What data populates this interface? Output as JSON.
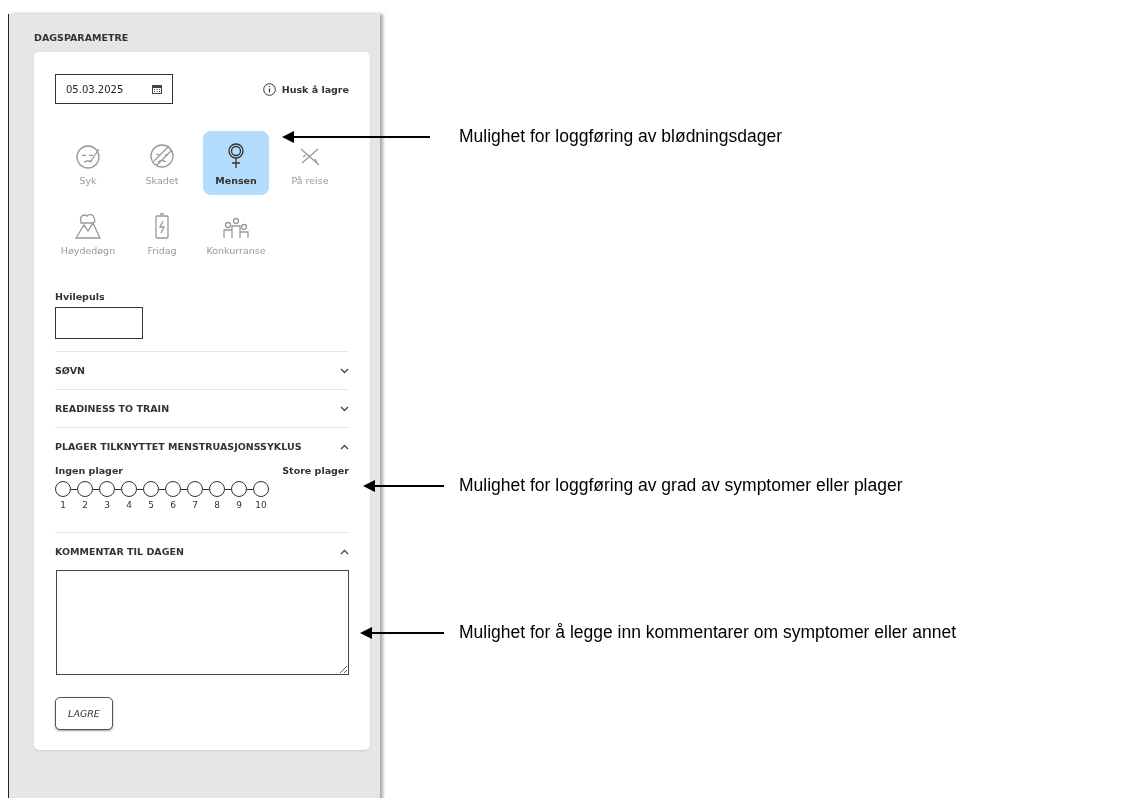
{
  "panel": {
    "title": "DAGSPARAMETRE"
  },
  "date_field": {
    "value": "05.03.2025"
  },
  "reminder": "Husk å lagre",
  "day_types": [
    {
      "kind": "sick",
      "label": "Syk",
      "selected": false
    },
    {
      "kind": "injured",
      "label": "Skadet",
      "selected": false
    },
    {
      "kind": "period",
      "label": "Mensen",
      "selected": true
    },
    {
      "kind": "travel",
      "label": "På reise",
      "selected": false
    },
    {
      "kind": "altitude",
      "label": "Høydedøgn",
      "selected": false
    },
    {
      "kind": "dayoff",
      "label": "Fridag",
      "selected": false
    },
    {
      "kind": "competition",
      "label": "Konkurranse",
      "selected": false
    }
  ],
  "resting_pulse": {
    "label": "Hvilepuls"
  },
  "sections": [
    {
      "title": "SØVN",
      "expanded": false
    },
    {
      "title": "READINESS TO TRAIN",
      "expanded": false
    },
    {
      "title": "PLAGER TILKNYTTET MENSTRUASJONSSYKLUS",
      "expanded": true,
      "kind": "scale",
      "low_label": "Ingen plager",
      "high_label": "Store plager",
      "steps": [
        {
          "label": "1",
          "selected": false
        },
        {
          "label": "2",
          "selected": false
        },
        {
          "label": "3",
          "selected": false
        },
        {
          "label": "4",
          "selected": false
        },
        {
          "label": "5",
          "selected": false
        },
        {
          "label": "6",
          "selected": false
        },
        {
          "label": "7",
          "selected": false
        },
        {
          "label": "8",
          "selected": false
        },
        {
          "label": "9",
          "selected": false
        },
        {
          "label": "10",
          "selected": false
        }
      ]
    },
    {
      "title": "KOMMENTAR TIL DAGEN",
      "expanded": true,
      "kind": "comment"
    }
  ],
  "save_button": "LAGRE",
  "annotations": [
    {
      "text": "Mulighet for loggføring av blødningsdager"
    },
    {
      "text": "Mulighet for loggføring av grad av symptomer eller plager"
    },
    {
      "text": "Mulighet for å legge inn kommentarer om symptomer eller annet"
    }
  ]
}
